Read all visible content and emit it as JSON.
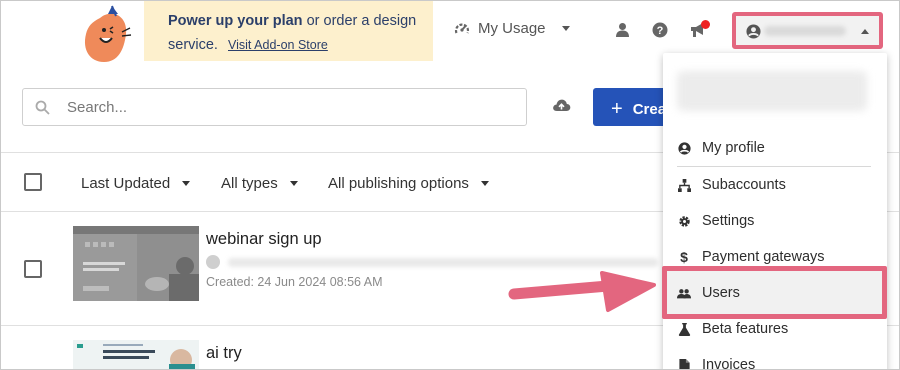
{
  "header": {
    "promo": {
      "bold": "Power up your plan",
      "rest": "or order a design service.",
      "link": "Visit Add-on Store"
    },
    "usage_label": "My Usage",
    "icons": [
      "user-icon",
      "help-icon",
      "megaphone-icon",
      "account-icon"
    ]
  },
  "toolbar": {
    "search_placeholder": "Search...",
    "create_label": "Crea"
  },
  "filters": [
    {
      "label": "Last Updated"
    },
    {
      "label": "All types"
    },
    {
      "label": "All publishing options"
    }
  ],
  "rows": [
    {
      "title": "webinar sign up",
      "created": "Created: 24 Jun 2024 08:56 AM"
    },
    {
      "title": "ai try"
    }
  ],
  "account_menu": {
    "items": [
      {
        "label": "My profile",
        "icon": "account-circle-icon"
      },
      {
        "label": "Subaccounts",
        "icon": "sitemap-icon"
      },
      {
        "label": "Settings",
        "icon": "gear-icon"
      },
      {
        "label": "Payment gateways",
        "icon": "dollar-icon"
      },
      {
        "label": "Users",
        "icon": "users-icon"
      },
      {
        "label": "Beta features",
        "icon": "flask-icon"
      },
      {
        "label": "Invoices",
        "icon": "file-icon"
      }
    ],
    "highlight_color": "#e3667f"
  },
  "colors": {
    "brand_blue": "#2553b8",
    "promo_bg": "#fdf0cd",
    "highlight": "#e3667f",
    "notification": "#ee2222"
  }
}
